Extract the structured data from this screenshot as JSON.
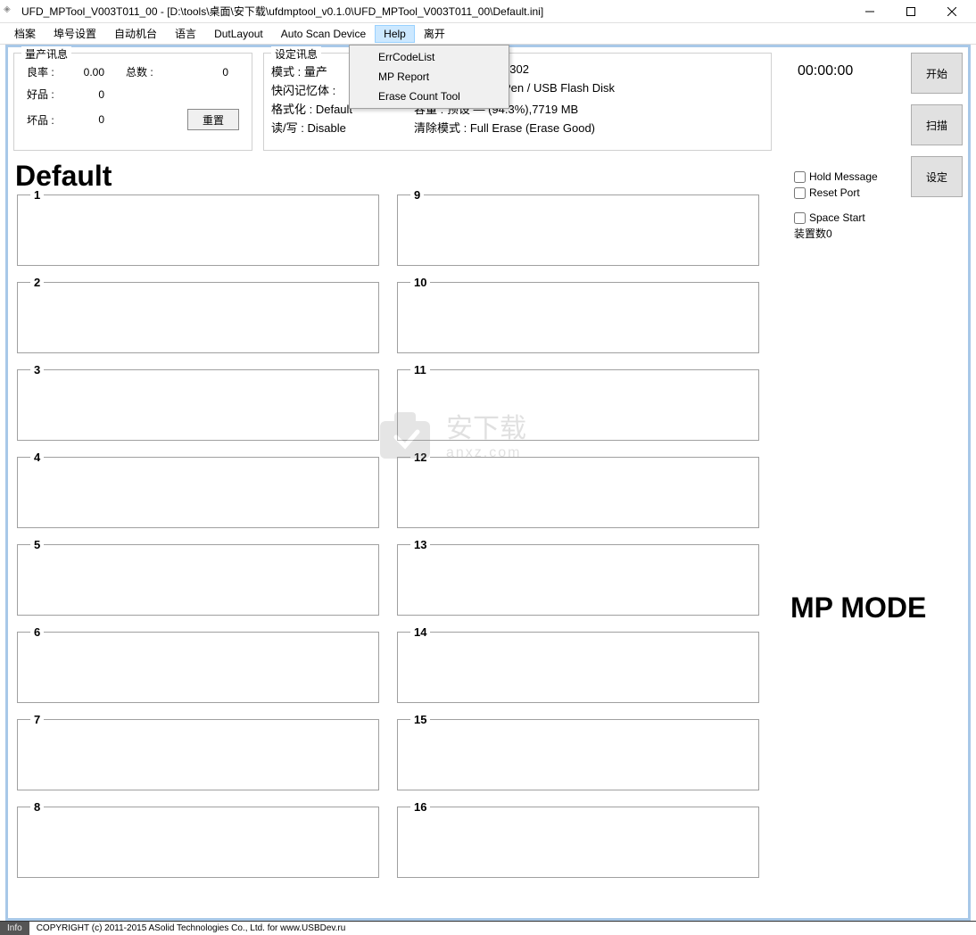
{
  "title": "UFD_MPTool_V003T011_00 - [D:\\tools\\桌面\\安下载\\ufdmptool_v0.1.0\\UFD_MPTool_V003T011_00\\Default.ini]",
  "menu": {
    "items": [
      "档案",
      "埠号设置",
      "自动机台",
      "语言",
      "DutLayout",
      "Auto Scan Device",
      "Help",
      "离开"
    ],
    "dropdown": [
      "ErrCodeList",
      "MP Report",
      "Erase Count Tool"
    ]
  },
  "production": {
    "title": "量产讯息",
    "yield_label": "良率 :",
    "yield_value": "0.00",
    "total_label": "总数 :",
    "total_value": "0",
    "good_label": "好品 :",
    "good_value": "0",
    "bad_label": "坏品 :",
    "bad_value": "0",
    "reset": "重置"
  },
  "settings": {
    "title": "设定讯息",
    "mode_label": "模式 : ",
    "mode_value": "量产",
    "controller_value": "1302",
    "flash_label": "快闪记忆体 : ",
    "pen_value": "Pen / USB Flash Disk",
    "format_label": "格式化 : ",
    "format_value": "Default",
    "capacity_label": "容量 : ",
    "capacity_value": "预设 — (94.3%),7719 MB",
    "rw_label": "读/写 : ",
    "rw_value": "Disable",
    "erase_label": "清除模式 : ",
    "erase_value": "Full Erase (Erase Good)"
  },
  "default_label": "Default",
  "slots_left": [
    "1",
    "2",
    "3",
    "4",
    "5",
    "6",
    "7",
    "8"
  ],
  "slots_right": [
    "9",
    "10",
    "11",
    "12",
    "13",
    "14",
    "15",
    "16"
  ],
  "right": {
    "timer": "00:00:00",
    "start": "开始",
    "scan": "扫描",
    "setting": "设定",
    "hold": "Hold Message",
    "reset_port": "Reset Port",
    "space_start": "Space Start",
    "dev_count": "装置数0",
    "mp_mode": "MP MODE"
  },
  "watermark": {
    "text": "安下载",
    "sub": "anxz.com"
  },
  "bottom": {
    "info": "Info",
    "copy": "COPYRIGHT (c) 2011-2015  ASolid Technologies Co., Ltd. for www.USBDev.ru"
  }
}
